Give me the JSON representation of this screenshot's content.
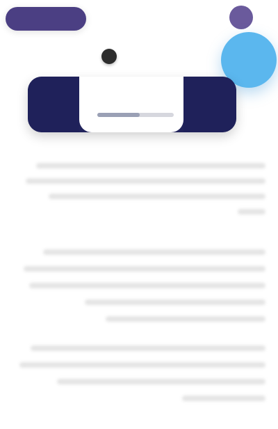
{
  "topbar": {
    "primary_action_label": "",
    "title": "",
    "avatar_label": ""
  },
  "left_label": "",
  "player": {
    "progress_fraction": 0.55
  },
  "content": {
    "blocks": [
      {
        "text": ""
      },
      {
        "text": ""
      },
      {
        "text": ""
      }
    ]
  },
  "colors": {
    "primary": "#4b3f83",
    "fab": "#5bb7ee",
    "card": "#22245c"
  }
}
